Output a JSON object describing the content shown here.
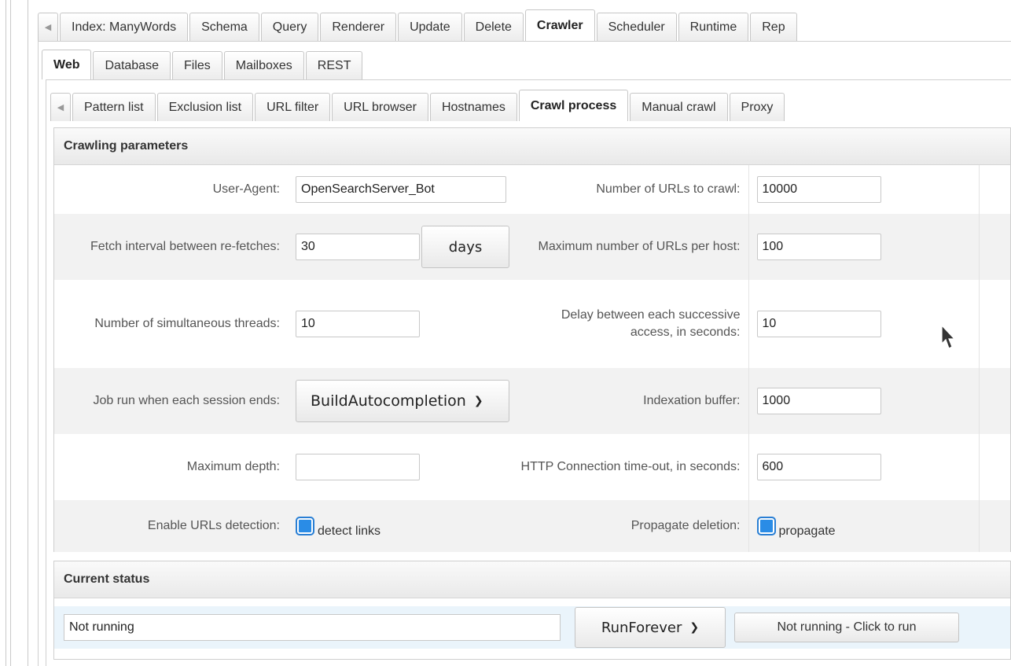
{
  "top_tabs": [
    {
      "label": "Index: ManyWords"
    },
    {
      "label": "Schema"
    },
    {
      "label": "Query"
    },
    {
      "label": "Renderer"
    },
    {
      "label": "Update"
    },
    {
      "label": "Delete"
    },
    {
      "label": "Crawler"
    },
    {
      "label": "Scheduler"
    },
    {
      "label": "Runtime"
    },
    {
      "label": "Rep"
    }
  ],
  "crawler_tabs": [
    {
      "label": "Web"
    },
    {
      "label": "Database"
    },
    {
      "label": "Files"
    },
    {
      "label": "Mailboxes"
    },
    {
      "label": "REST"
    }
  ],
  "web_tabs": [
    {
      "label": "Pattern list"
    },
    {
      "label": "Exclusion list"
    },
    {
      "label": "URL filter"
    },
    {
      "label": "URL browser"
    },
    {
      "label": "Hostnames"
    },
    {
      "label": "Crawl process"
    },
    {
      "label": "Manual crawl"
    },
    {
      "label": "Proxy"
    }
  ],
  "crawling": {
    "title": "Crawling parameters",
    "user_agent_label": "User-Agent:",
    "user_agent": "OpenSearchServer_Bot",
    "num_urls_label": "Number of URLs to crawl:",
    "num_urls": "10000",
    "fetch_interval_label": "Fetch interval between re-fetches:",
    "fetch_interval": "30",
    "fetch_interval_unit": "days",
    "max_urls_host_label": "Maximum number of URLs per host:",
    "max_urls_host": "100",
    "threads_label": "Number of simultaneous threads:",
    "threads": "10",
    "delay_label": "Delay between each successive access, in seconds:",
    "delay": "10",
    "job_label": "Job run when each session ends:",
    "job": "BuildAutocompletion",
    "index_buffer_label": "Indexation buffer:",
    "index_buffer": "1000",
    "max_depth_label": "Maximum depth:",
    "max_depth": "",
    "http_timeout_label": "HTTP Connection time-out, in seconds:",
    "http_timeout": "600",
    "enable_urls_label": "Enable URLs detection:",
    "detect_links": "detect links",
    "propagate_label": "Propagate deletion:",
    "propagate": "propagate"
  },
  "status": {
    "title": "Current status",
    "value": "Not running",
    "mode": "RunForever",
    "run_button": "Not running - Click to run"
  },
  "colors": {
    "checkbox": "#2a8ce6",
    "status_bg": "#eaf4fb"
  }
}
